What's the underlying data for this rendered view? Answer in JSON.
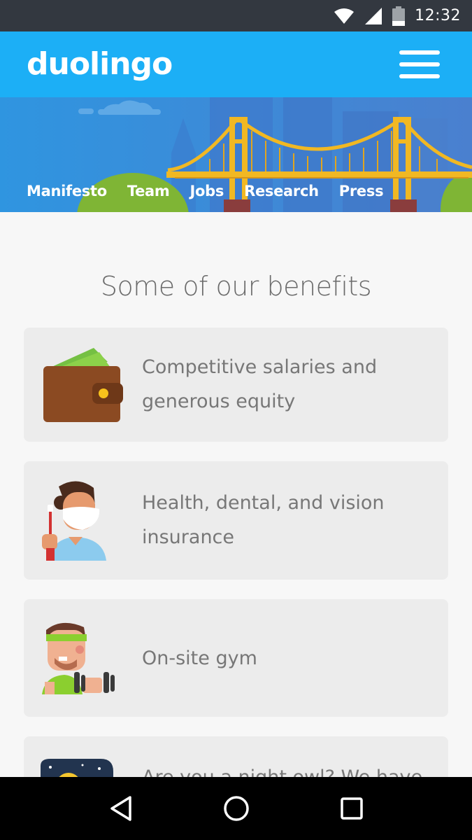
{
  "status_bar": {
    "time": "12:32",
    "icons": [
      "wifi-icon",
      "signal-icon",
      "battery-icon"
    ]
  },
  "header": {
    "logo": "duolingo",
    "menu_icon": "hamburger-menu-icon",
    "brand_color": "#1caff6"
  },
  "hero": {
    "nav": [
      {
        "label": "Manifesto"
      },
      {
        "label": "Team"
      },
      {
        "label": "Jobs"
      },
      {
        "label": "Research"
      },
      {
        "label": "Press"
      }
    ]
  },
  "benefits_section": {
    "title": "Some of our benefits",
    "items": [
      {
        "text": "Competitive salaries and generous equity",
        "icon": "wallet-icon"
      },
      {
        "text": "Health, dental, and vision insurance",
        "icon": "dentist-icon"
      },
      {
        "text": "On-site gym",
        "icon": "gym-icon"
      },
      {
        "text": "Are you a night owl? We have",
        "icon": "night-owl-icon"
      }
    ]
  },
  "nav_bar": {
    "buttons": [
      "back-icon",
      "home-icon",
      "recents-icon"
    ]
  }
}
